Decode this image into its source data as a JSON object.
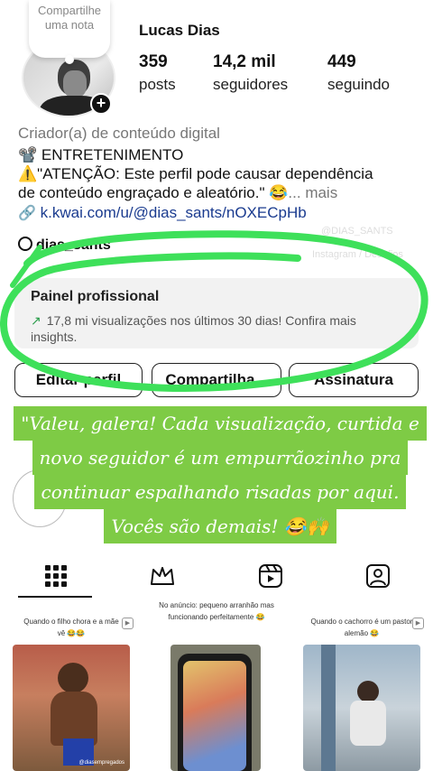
{
  "profile": {
    "note": "Compartilhe uma nota",
    "username": "Lucas Dias",
    "category": "Criador(a) de conteúdo digital",
    "bio_line1": "📽️ ENTRETENIMENTO",
    "bio_line2": "⚠️\"ATENÇÃO: Este perfil pode causar dependência",
    "bio_line3": "de conteúdo engraçado e aleatório.\" 😂",
    "bio_more": "... mais",
    "link": "k.kwai.com/u/@dias_sants/nOXECpHb",
    "threads": "dias_sants",
    "watermark1": "@DIAS_SANTS",
    "watermark2": "Instagram / Desafios"
  },
  "stats": [
    {
      "value": "359",
      "label": "posts"
    },
    {
      "value": "14,2 mil",
      "label": "seguidores"
    },
    {
      "value": "449",
      "label": "seguindo"
    }
  ],
  "panel": {
    "title": "Painel profissional",
    "body": "17,8 mi visualizações nos últimos 30 dias! Confira mais insights."
  },
  "buttons": {
    "edit": "Editar perfil",
    "share": "Compartilha...",
    "subscribe": "Assinatura"
  },
  "banner": {
    "line1": "\"Valeu, galera! Cada visualização, curtida e",
    "line2": "novo seguidor é um empurrãozinho pra",
    "line3": "continuar espalhando risadas por aqui.",
    "line4": "Vocês são demais! 😂🙌"
  },
  "posts": [
    {
      "caption": "Quando o filho chora e a mãe vê 😂😂",
      "thumb_text": "@diasempregados"
    },
    {
      "caption": "No anúncio: pequeno arranhão mas funcionando perfeitamente 😂",
      "thumb_text": ""
    },
    {
      "caption": "Quando o cachorro é um pastor alemão 😂",
      "thumb_text": ""
    }
  ],
  "colors": {
    "highlight": "#3ee05a",
    "banner": "#7ecb45",
    "link": "#1a3b8f"
  }
}
